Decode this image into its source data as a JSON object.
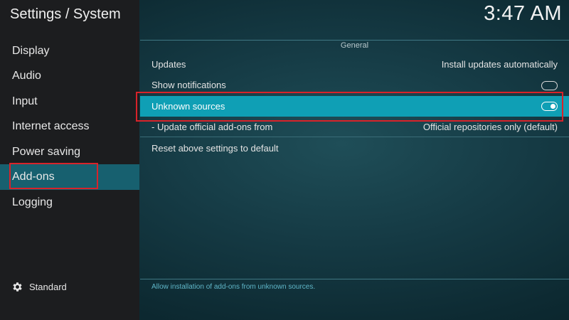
{
  "window": {
    "title": "Settings / System",
    "clock": "3:47 AM"
  },
  "sidebar": {
    "items": [
      {
        "label": "Display"
      },
      {
        "label": "Audio"
      },
      {
        "label": "Input"
      },
      {
        "label": "Internet access"
      },
      {
        "label": "Power saving"
      },
      {
        "label": "Add-ons",
        "selected": true
      },
      {
        "label": "Logging"
      }
    ],
    "level_label": "Standard",
    "level_icon": "gear-icon"
  },
  "content": {
    "section_title": "General",
    "rows": [
      {
        "label": "Updates",
        "value": "Install updates automatically"
      },
      {
        "label": "Show notifications",
        "toggle": "off"
      },
      {
        "label": "Unknown sources",
        "toggle": "on",
        "focused": true
      },
      {
        "label": "- Update official add-ons from",
        "value": "Official repositories only (default)"
      },
      {
        "label": "Reset above settings to default"
      }
    ],
    "hint": "Allow installation of add-ons from unknown sources."
  },
  "colors": {
    "accent_focus": "#0f9fb5",
    "selected_nav": "#17606f",
    "highlight_box": "#d8232a"
  }
}
